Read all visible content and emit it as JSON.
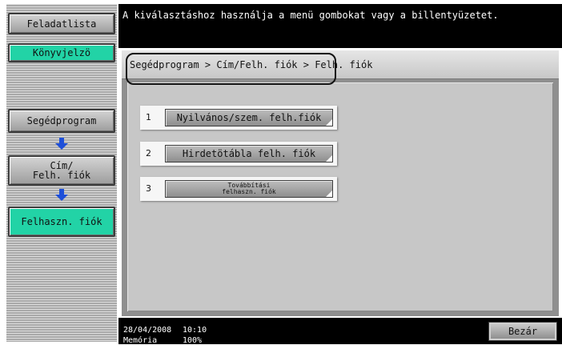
{
  "sidebar": {
    "task_list": "Feladatlista",
    "bookmark": "Könyvjelzö",
    "nav": [
      "Segédprogram",
      "Cím/\nFelh. fiók",
      "Felhaszn. fiók"
    ]
  },
  "message": "A kiválasztáshoz használja a menü gombokat vagy a billentyüzetet.",
  "breadcrumb": "Segédprogram > Cím/Felh. fiók > Felh. fiók",
  "options": [
    {
      "number": "1",
      "label": "Nyilvános/szem. felh.fiók"
    },
    {
      "number": "2",
      "label": "Hirdetötábla felh. fiók"
    },
    {
      "number": "3",
      "label": "Továbbítási\nfelhaszn. fiók"
    }
  ],
  "status": {
    "date": "28/04/2008",
    "time": "10:10",
    "memory_label": "Memória",
    "memory_value": "100%"
  },
  "close_label": "Bezár",
  "colors": {
    "accent_green": "#22d3a6",
    "arrow_blue": "#1e4fd8",
    "highlight": "#111111"
  }
}
